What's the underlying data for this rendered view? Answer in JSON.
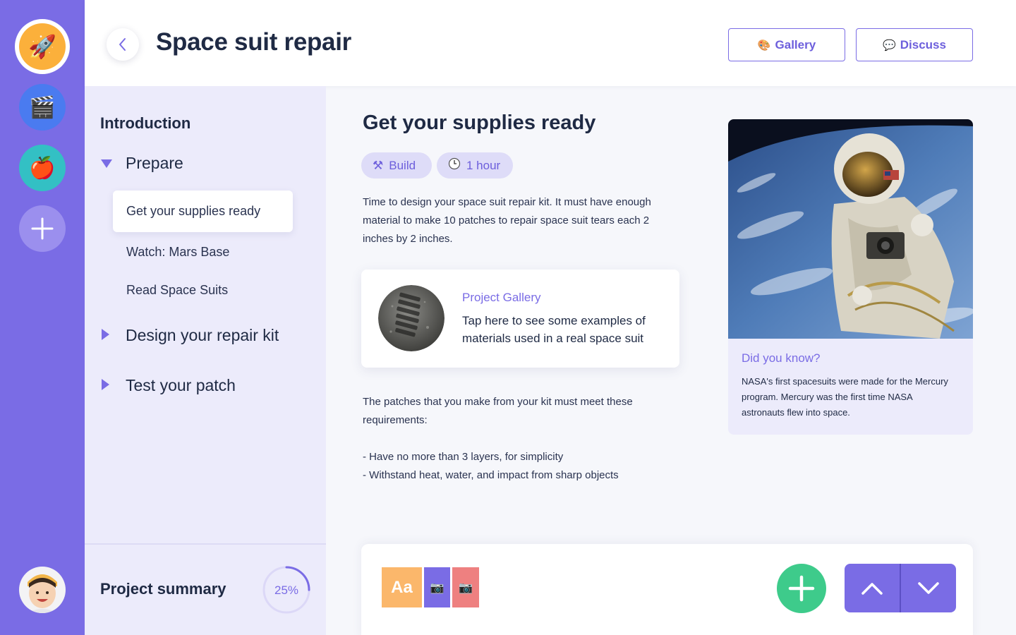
{
  "header": {
    "title": "Space suit repair",
    "gallery_label": "Gallery",
    "discuss_label": "Discuss"
  },
  "rail": {
    "items": [
      {
        "icon": "rocket-icon",
        "glyph": "🚀",
        "color": "#fbb03b",
        "active": true
      },
      {
        "icon": "clapperboard-icon",
        "glyph": "🎬",
        "color": "#4a7bf0"
      },
      {
        "icon": "apple-icon",
        "glyph": "🍎",
        "color": "#33c0c4"
      },
      {
        "icon": "plus-icon",
        "glyph": "+",
        "color": "#9b8fee"
      }
    ]
  },
  "sidebar": {
    "intro": "Introduction",
    "sections": [
      {
        "label": "Prepare",
        "expanded": true
      },
      {
        "label": "Design your repair kit",
        "expanded": false
      },
      {
        "label": "Test your patch",
        "expanded": false
      }
    ],
    "sub_items": [
      "Get your supplies ready",
      "Watch: Mars Base",
      "Read Space Suits"
    ],
    "summary_label": "Project summary",
    "progress_percent": 25,
    "progress_text": "25%"
  },
  "main": {
    "title": "Get your supplies ready",
    "tags": [
      {
        "label": "Build",
        "icon": "tools-icon"
      },
      {
        "label": "1 hour",
        "icon": "clock-icon"
      }
    ],
    "intro": "Time to design your space suit repair kit. It must have enough material to make 10 patches to repair space suit tears each 2 inches by 2 inches.",
    "gallery_card": {
      "title": "Project Gallery",
      "description": "Tap here to see some examples of materials used in a real space suit"
    },
    "requirements_intro": "The patches that you make from your kit must meet these requirements:",
    "requirements": [
      "- Have no more than 3 layers, for simplicity",
      "- Withstand heat, water, and impact from sharp objects"
    ]
  },
  "did_you_know": {
    "title": "Did you know?",
    "text": "NASA's first spacesuits were made for the Mercury program. Mercury was the first time NASA astronauts flew into space."
  },
  "toolbar": {
    "text_chip": "Aa",
    "colors": {
      "text": "#fbb76b",
      "photo1": "#7a6ce5",
      "photo2": "#ee8080",
      "add": "#3ecb8b",
      "nav": "#7a6ce5"
    }
  },
  "colors": {
    "accent": "#7a6ce5",
    "rail": "#7a6ce5",
    "sidebar_bg": "#ecebfb",
    "text": "#1f2a44"
  }
}
